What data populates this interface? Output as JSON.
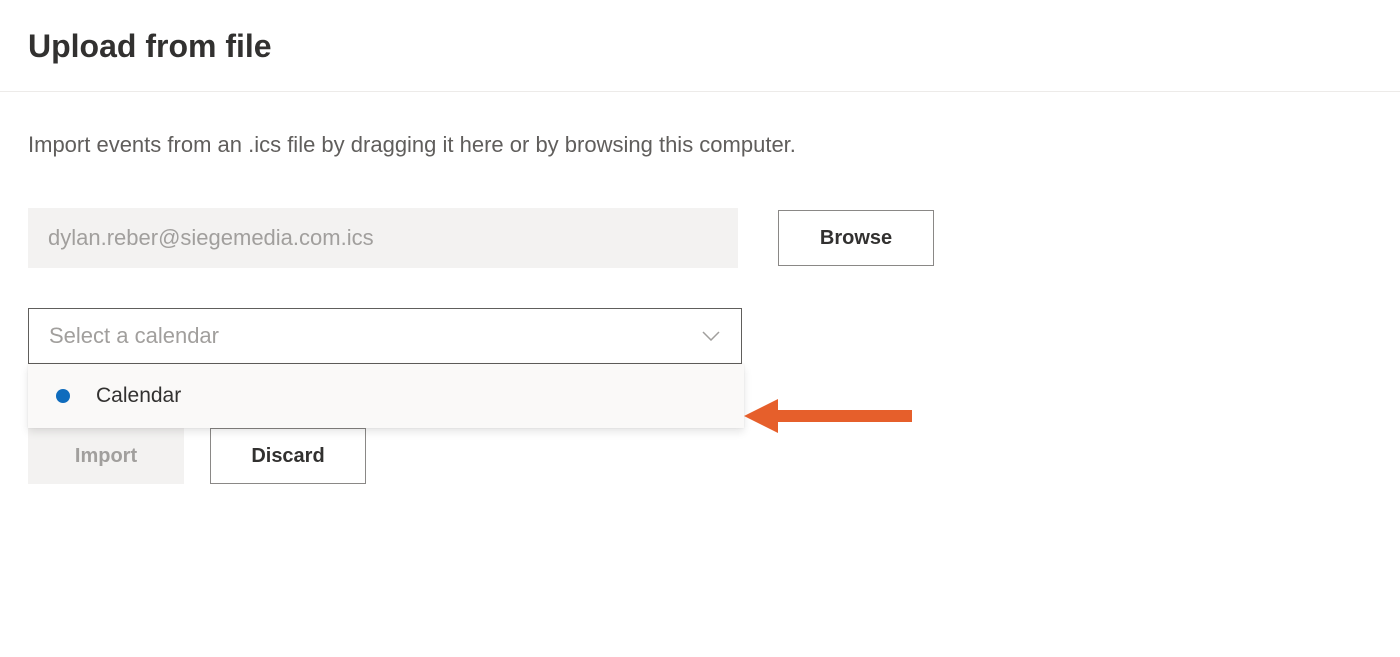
{
  "header": {
    "title": "Upload from file"
  },
  "description": "Import events from an .ics file by dragging it here or by browsing this computer.",
  "file": {
    "placeholder": "dylan.reber@siegemedia.com.ics",
    "browse_label": "Browse"
  },
  "calendar_select": {
    "placeholder": "Select a calendar",
    "options": [
      {
        "label": "Calendar",
        "color": "#0f6cbd"
      }
    ]
  },
  "buttons": {
    "import_label": "Import",
    "discard_label": "Discard"
  },
  "colors": {
    "accent": "#0f6cbd",
    "annotation": "#e65f2b"
  }
}
